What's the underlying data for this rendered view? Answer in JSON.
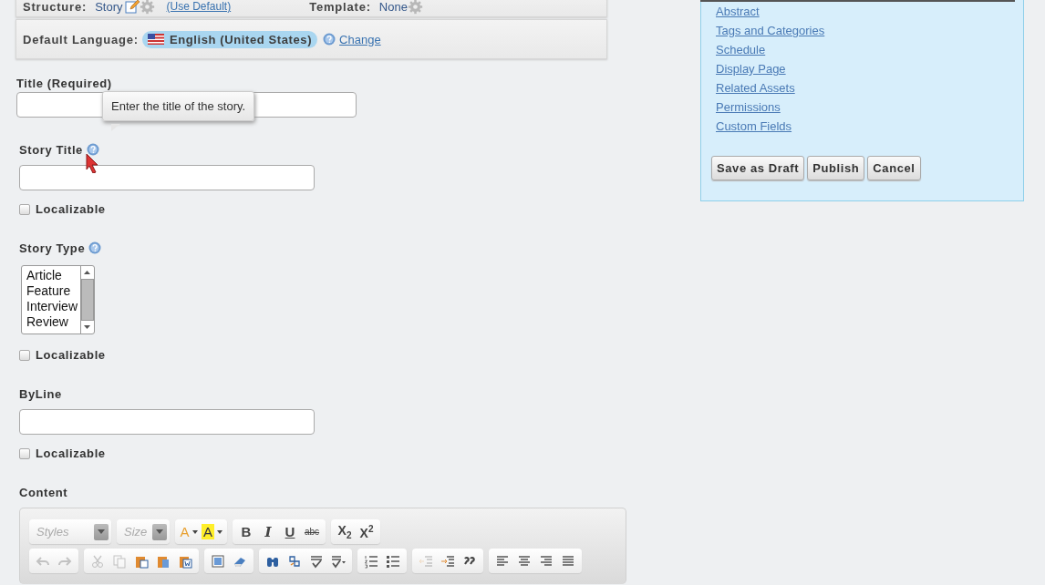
{
  "structure": {
    "label": "Structure:",
    "value": "Story",
    "use_default": "(Use Default)",
    "template_label": "Template:",
    "template_value": "None"
  },
  "language": {
    "label": "Default Language:",
    "value": "English (United States)",
    "change": "Change"
  },
  "fields": [
    {
      "kind": "text",
      "label": "Title (Required)",
      "help": false,
      "tooltip": "Enter the title of the story."
    },
    {
      "kind": "text",
      "label": "Story Title",
      "help": true,
      "localizable": {
        "label": "Localizable",
        "checked": false
      }
    },
    {
      "kind": "list",
      "label": "Story Type",
      "help": true,
      "options": [
        {
          "label": "Article",
          "selected": false
        },
        {
          "label": "Feature",
          "selected": false
        },
        {
          "label": "Interview",
          "selected": false
        },
        {
          "label": "Review",
          "selected": false
        }
      ],
      "localizable": {
        "label": "Localizable",
        "checked": false
      }
    },
    {
      "kind": "text",
      "label": "ByLine",
      "help": false,
      "localizable": {
        "label": "Localizable",
        "checked": false
      }
    },
    {
      "kind": "editor",
      "label": "Content",
      "help": false
    }
  ],
  "toolbar": [
    [
      [
        {
          "kind": "combo",
          "placeholder": "Styles"
        }
      ],
      [
        {
          "kind": "combo",
          "placeholder": "Size"
        }
      ],
      [
        {
          "kind": "font-color",
          "label": "A",
          "disabled": false
        },
        {
          "kind": "bg-color",
          "label": "A",
          "disabled": false
        }
      ],
      [
        {
          "kind": "bold",
          "label": "B",
          "disabled": false
        },
        {
          "kind": "italic",
          "label": "I",
          "disabled": false
        },
        {
          "kind": "underline",
          "label": "U",
          "disabled": false
        },
        {
          "kind": "strike",
          "label": "abc",
          "disabled": false
        }
      ],
      [
        {
          "kind": "subscript",
          "label": "X$_{2}$",
          "disabled": false
        },
        {
          "kind": "superscript",
          "label": "X$^{2}$",
          "disabled": false
        }
      ]
    ],
    [
      [
        {
          "kind": "undo",
          "disabled": true
        },
        {
          "kind": "redo",
          "disabled": true
        }
      ],
      [
        {
          "kind": "cut",
          "disabled": true
        },
        {
          "kind": "copy",
          "disabled": true
        },
        {
          "kind": "paste",
          "disabled": false
        },
        {
          "kind": "paste-text",
          "disabled": false
        },
        {
          "kind": "paste-word",
          "disabled": false
        }
      ],
      [
        {
          "kind": "select-all",
          "disabled": false
        },
        {
          "kind": "eraser",
          "disabled": false
        }
      ],
      [
        {
          "kind": "find",
          "disabled": false
        },
        {
          "kind": "replace",
          "disabled": false
        },
        {
          "kind": "spell",
          "disabled": false
        },
        {
          "kind": "spell-menu",
          "disabled": false
        }
      ],
      [
        {
          "kind": "numbered",
          "disabled": false
        },
        {
          "kind": "bullets",
          "disabled": false
        }
      ],
      [
        {
          "kind": "outdent",
          "disabled": true
        },
        {
          "kind": "indent",
          "disabled": false
        },
        {
          "kind": "quote",
          "disabled": false
        }
      ],
      [
        {
          "kind": "align-left",
          "disabled": false
        },
        {
          "kind": "align-center",
          "disabled": false
        },
        {
          "kind": "align-right",
          "disabled": false
        },
        {
          "kind": "justify",
          "disabled": false
        }
      ]
    ]
  ],
  "sidebar": {
    "links": [
      "Abstract",
      "Tags and Categories",
      "Schedule",
      "Display Page",
      "Related Assets",
      "Permissions",
      "Custom Fields"
    ],
    "buttons": [
      "Save as Draft",
      "Publish",
      "Cancel"
    ]
  }
}
